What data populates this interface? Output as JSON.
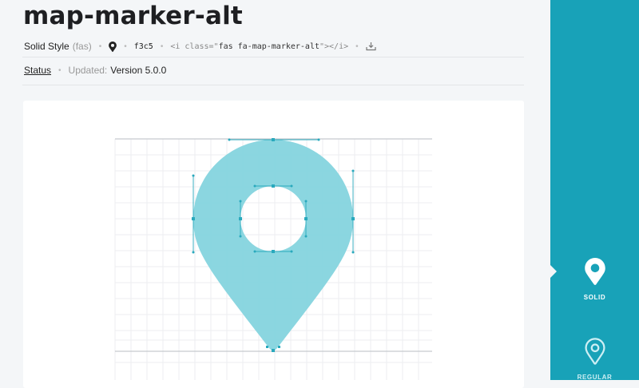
{
  "icon": {
    "name": "map-marker-alt",
    "style_name": "Solid Style",
    "style_code": "(fas)",
    "unicode": "f3c5",
    "snippet_prefix": "<i class=\"",
    "snippet_class": "fas fa-map-marker-alt",
    "snippet_suffix": "\"></i>",
    "status_label": "Status",
    "updated_label": "Updated:",
    "updated_version": "Version 5.0.0"
  },
  "sidebar": {
    "options": [
      {
        "label": "SOLID",
        "selected": true,
        "icon": "map-marker-solid-icon"
      },
      {
        "label": "REGULAR",
        "selected": false,
        "icon": "map-marker-regular-icon"
      }
    ]
  },
  "colors": {
    "accent": "#18a2b8",
    "glyph_fill": "#85d4de",
    "guide": "#29a9bd"
  }
}
